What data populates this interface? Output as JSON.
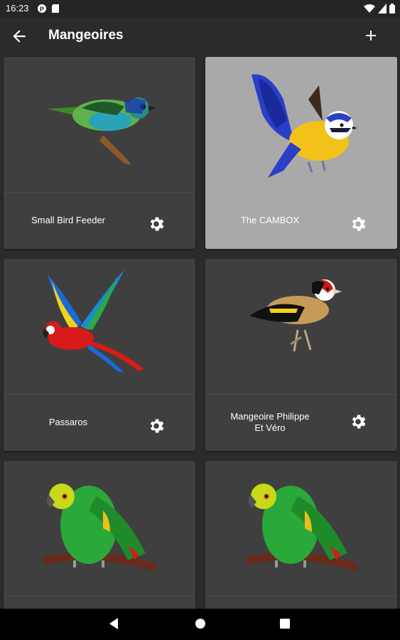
{
  "status_bar": {
    "time": "16:23"
  },
  "app_bar": {
    "title": "Mangeoires"
  },
  "cards": [
    {
      "label": "Small Bird Feeder",
      "image": "colorful-tanager-bird-image",
      "selected": false
    },
    {
      "label": "The CAMBOX",
      "image": "blue-tit-bird-image",
      "selected": true
    },
    {
      "label": "Passaros",
      "image": "macaw-parrot-image",
      "selected": false
    },
    {
      "label": "Mangeoire Philippe\nEt Véro",
      "label_line1": "Mangeoire Philippe",
      "label_line2": "Et Véro",
      "image": "goldfinch-bird-image",
      "selected": false
    },
    {
      "label": "",
      "image": "green-amazon-parrot-image",
      "selected": false
    },
    {
      "label": "",
      "image": "green-amazon-parrot-image",
      "selected": false
    }
  ],
  "colors": {
    "background": "#2b2b2b",
    "card": "#3f3f3f",
    "card_selected": "#a9a9a9"
  }
}
